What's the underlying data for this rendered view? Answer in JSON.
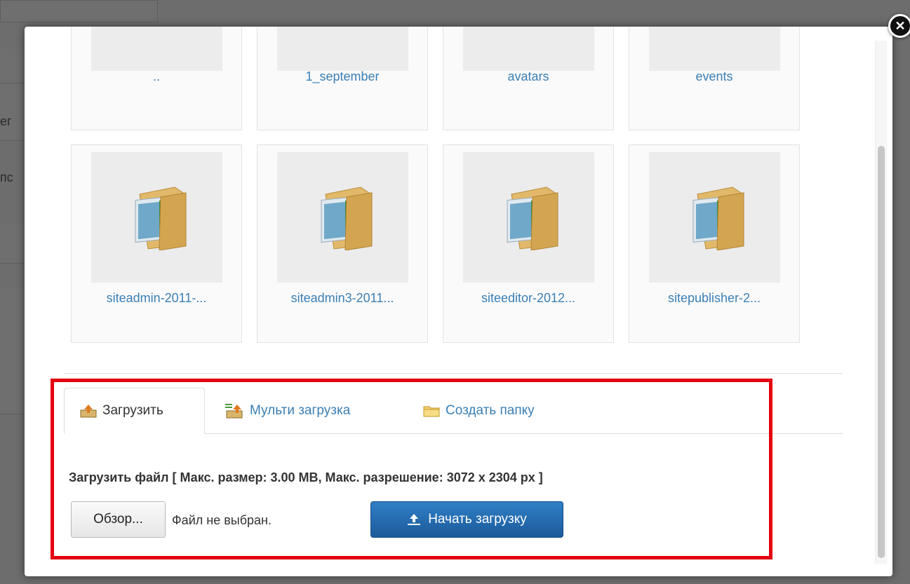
{
  "background": {
    "fragment_1": "ег",
    "fragment_2": "пс"
  },
  "folders": [
    {
      "label": ".."
    },
    {
      "label": "1_september"
    },
    {
      "label": "avatars"
    },
    {
      "label": "events"
    },
    {
      "label": "siteadmin-2011-..."
    },
    {
      "label": "siteadmin3-2011..."
    },
    {
      "label": "siteeditor-2012..."
    },
    {
      "label": "sitepublisher-2..."
    }
  ],
  "tabs": [
    {
      "label": "Загрузить",
      "icon": "upload-icon"
    },
    {
      "label": "Мульти загрузка",
      "icon": "multi-upload-icon"
    },
    {
      "label": "Создать папку",
      "icon": "folder-icon"
    }
  ],
  "upload": {
    "title": "Загрузить файл [ Макс. размер: 3.00 MB, Макс. разрешение: 3072 x 2304 px ]",
    "browse_label": "Обзор...",
    "no_file_text": "Файл не выбран.",
    "start_label": "Начать загрузку"
  },
  "colors": {
    "accent": "#1c5a9a",
    "link": "#3a7fb5",
    "highlight": "#e4000f"
  }
}
